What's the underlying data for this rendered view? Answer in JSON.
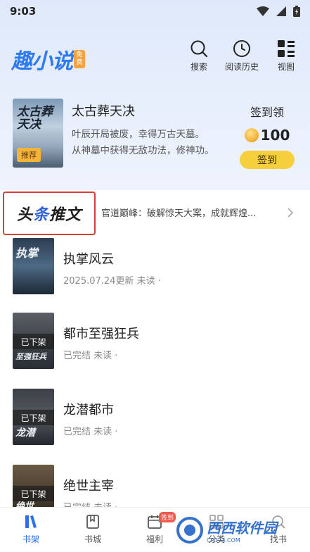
{
  "status_bar": {
    "time": "9:03"
  },
  "header": {
    "logo_text": "趣小说",
    "logo_badge": "免费",
    "search_label": "搜索",
    "history_label": "阅读历史",
    "view_label": "视图"
  },
  "featured": {
    "cover_title": "太古葬天决",
    "tag": "推荐",
    "title": "太古葬天决",
    "desc_line1": "叶辰开局被废，幸得万古天墓。",
    "desc_line2": "从神墓中获得无敌功法，修神功。"
  },
  "checkin": {
    "title": "签到领",
    "coins": "100",
    "button": "签到"
  },
  "headline": {
    "badge_part1": "头",
    "badge_part2": "条",
    "badge_part3": "推文",
    "text": "官道巅峰：破解惊天大案，成就辉煌..."
  },
  "books": [
    {
      "title": "执掌风云",
      "meta": "2025.07.24更新 未读 ·",
      "cover_text": "执掌",
      "off_shelf": ""
    },
    {
      "title": "都市至强狂兵",
      "meta": "已完结 未读 ·",
      "cover_text": "至强狂兵",
      "off_shelf": "已下架"
    },
    {
      "title": "龙潜都市",
      "meta": "已完结 未读 ·",
      "cover_text": "龙潜",
      "off_shelf": "已下架"
    },
    {
      "title": "绝世主宰",
      "meta": "已完结 未读 ·",
      "cover_text": "绝世",
      "off_shelf": "已下架"
    }
  ],
  "bottom_nav": {
    "shelf": "书架",
    "store": "书城",
    "welfare": "福利",
    "welfare_badge": "签到",
    "category": "分类",
    "find": "找书"
  },
  "watermark": {
    "text": "西西软件园",
    "sub": "CR173.COM"
  },
  "colors": {
    "accent": "#2e6ff0",
    "highlight_border": "#d4422f",
    "checkin_button": "#f5cf3c"
  }
}
